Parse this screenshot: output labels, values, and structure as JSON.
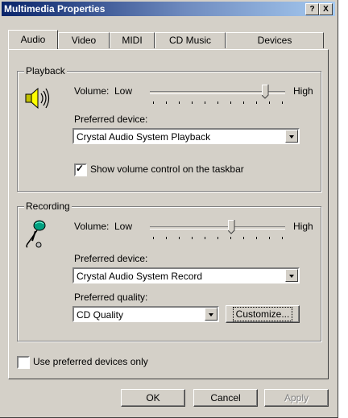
{
  "window": {
    "title": "Multimedia Properties",
    "help_label": "?",
    "close_label": "X"
  },
  "tabs": [
    {
      "label": "Audio",
      "active": true
    },
    {
      "label": "Video",
      "active": false
    },
    {
      "label": "MIDI",
      "active": false
    },
    {
      "label": "CD Music",
      "active": false
    },
    {
      "label": "Devices",
      "active": false
    }
  ],
  "playback": {
    "group_label": "Playback",
    "volume_label": "Volume:",
    "volume_low": "Low",
    "volume_high": "High",
    "volume_level": 0.85,
    "preferred_device_label": "Preferred device:",
    "preferred_device_value": "Crystal Audio System Playback",
    "show_volume_checkbox_label": "Show volume control on the taskbar",
    "show_volume_checked": true
  },
  "recording": {
    "group_label": "Recording",
    "volume_label": "Volume:",
    "volume_low": "Low",
    "volume_high": "High",
    "volume_level": 0.6,
    "preferred_device_label": "Preferred device:",
    "preferred_device_value": "Crystal Audio System Record",
    "preferred_quality_label": "Preferred quality:",
    "preferred_quality_value": "CD Quality",
    "customize_label": "Customize..."
  },
  "use_preferred_only": {
    "label": "Use preferred devices only",
    "checked": false
  },
  "buttons": {
    "ok": "OK",
    "cancel": "Cancel",
    "apply": "Apply"
  },
  "icons": {
    "playback": "speaker-icon",
    "recording": "microphone-icon"
  }
}
